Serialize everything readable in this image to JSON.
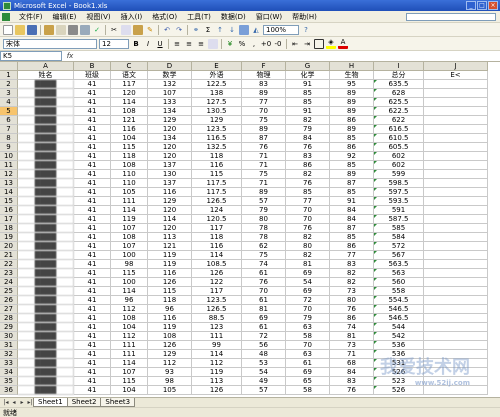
{
  "window": {
    "title": "Microsoft Excel - Book1.xls"
  },
  "menu": [
    "文件(F)",
    "编辑(E)",
    "视图(V)",
    "插入(I)",
    "格式(O)",
    "工具(T)",
    "数据(D)",
    "窗口(W)",
    "帮助(H)"
  ],
  "toolbar": {
    "zoom": "100%"
  },
  "format": {
    "font": "宋体",
    "size": "12"
  },
  "formula": {
    "cell": "K5",
    "fx": "fx",
    "value": ""
  },
  "columns": [
    "A",
    "B",
    "C",
    "D",
    "E",
    "F",
    "G",
    "H",
    "I",
    "J"
  ],
  "header_row": {
    "num": "1",
    "cells": [
      "姓名",
      "班级",
      "语文",
      "数学",
      "外语",
      "物理",
      "化学",
      "生物",
      "总分",
      "E<"
    ]
  },
  "rows": [
    {
      "num": "2",
      "cells": [
        "████",
        "41",
        "117",
        "132",
        "122.5",
        "83",
        "91",
        "95",
        "635.5",
        ""
      ]
    },
    {
      "num": "3",
      "cells": [
        "████",
        "41",
        "120",
        "107",
        "138",
        "89",
        "85",
        "89",
        "628",
        ""
      ]
    },
    {
      "num": "4",
      "cells": [
        "████",
        "41",
        "114",
        "133",
        "127.5",
        "77",
        "85",
        "89",
        "625.5",
        ""
      ]
    },
    {
      "num": "5",
      "cells": [
        "████",
        "41",
        "108",
        "134",
        "130.5",
        "70",
        "91",
        "89",
        "622.5",
        ""
      ]
    },
    {
      "num": "6",
      "cells": [
        "████",
        "41",
        "121",
        "129",
        "129",
        "75",
        "82",
        "86",
        "622",
        ""
      ]
    },
    {
      "num": "7",
      "cells": [
        "████",
        "41",
        "116",
        "120",
        "123.5",
        "89",
        "79",
        "89",
        "616.5",
        ""
      ]
    },
    {
      "num": "8",
      "cells": [
        "████",
        "41",
        "104",
        "134",
        "116.5",
        "87",
        "84",
        "85",
        "610.5",
        ""
      ]
    },
    {
      "num": "9",
      "cells": [
        "████",
        "41",
        "115",
        "120",
        "132.5",
        "76",
        "76",
        "86",
        "605.5",
        ""
      ]
    },
    {
      "num": "10",
      "cells": [
        "████",
        "41",
        "118",
        "120",
        "118",
        "71",
        "83",
        "92",
        "602",
        ""
      ]
    },
    {
      "num": "11",
      "cells": [
        "████",
        "41",
        "108",
        "137",
        "116",
        "71",
        "86",
        "85",
        "602",
        ""
      ]
    },
    {
      "num": "12",
      "cells": [
        "████",
        "41",
        "110",
        "130",
        "115",
        "75",
        "82",
        "89",
        "599",
        ""
      ]
    },
    {
      "num": "13",
      "cells": [
        "████",
        "41",
        "110",
        "137",
        "117.5",
        "71",
        "76",
        "87",
        "598.5",
        ""
      ]
    },
    {
      "num": "14",
      "cells": [
        "████",
        "41",
        "105",
        "116",
        "117.5",
        "89",
        "85",
        "85",
        "597.5",
        ""
      ]
    },
    {
      "num": "15",
      "cells": [
        "████",
        "41",
        "111",
        "129",
        "126.5",
        "57",
        "77",
        "91",
        "593.5",
        ""
      ]
    },
    {
      "num": "16",
      "cells": [
        "████",
        "41",
        "114",
        "120",
        "124",
        "79",
        "70",
        "84",
        "591",
        ""
      ]
    },
    {
      "num": "17",
      "cells": [
        "████",
        "41",
        "119",
        "114",
        "120.5",
        "80",
        "70",
        "84",
        "587.5",
        ""
      ]
    },
    {
      "num": "18",
      "cells": [
        "████",
        "41",
        "107",
        "120",
        "117",
        "78",
        "76",
        "87",
        "585",
        ""
      ]
    },
    {
      "num": "19",
      "cells": [
        "████",
        "41",
        "108",
        "113",
        "118",
        "78",
        "82",
        "85",
        "584",
        ""
      ]
    },
    {
      "num": "20",
      "cells": [
        "████",
        "41",
        "107",
        "121",
        "116",
        "62",
        "80",
        "86",
        "572",
        ""
      ]
    },
    {
      "num": "21",
      "cells": [
        "████",
        "41",
        "100",
        "119",
        "114",
        "75",
        "82",
        "77",
        "567",
        ""
      ]
    },
    {
      "num": "22",
      "cells": [
        "████",
        "41",
        "98",
        "119",
        "108.5",
        "74",
        "81",
        "83",
        "563.5",
        ""
      ]
    },
    {
      "num": "23",
      "cells": [
        "████",
        "41",
        "115",
        "116",
        "126",
        "61",
        "69",
        "82",
        "563",
        ""
      ]
    },
    {
      "num": "24",
      "cells": [
        "████",
        "41",
        "100",
        "126",
        "122",
        "76",
        "54",
        "82",
        "560",
        ""
      ]
    },
    {
      "num": "25",
      "cells": [
        "████",
        "41",
        "114",
        "115",
        "117",
        "70",
        "69",
        "73",
        "558",
        ""
      ]
    },
    {
      "num": "26",
      "cells": [
        "████",
        "41",
        "96",
        "118",
        "123.5",
        "61",
        "72",
        "80",
        "554.5",
        ""
      ]
    },
    {
      "num": "27",
      "cells": [
        "████",
        "41",
        "112",
        "96",
        "126.5",
        "81",
        "70",
        "76",
        "546.5",
        ""
      ]
    },
    {
      "num": "28",
      "cells": [
        "████",
        "41",
        "108",
        "116",
        "88.5",
        "69",
        "79",
        "86",
        "546.5",
        ""
      ]
    },
    {
      "num": "29",
      "cells": [
        "████",
        "41",
        "104",
        "119",
        "123",
        "61",
        "63",
        "74",
        "544",
        ""
      ]
    },
    {
      "num": "30",
      "cells": [
        "████",
        "41",
        "112",
        "108",
        "111",
        "72",
        "58",
        "81",
        "542",
        ""
      ]
    },
    {
      "num": "31",
      "cells": [
        "████",
        "41",
        "111",
        "126",
        "99",
        "56",
        "70",
        "73",
        "536",
        ""
      ]
    },
    {
      "num": "32",
      "cells": [
        "████",
        "41",
        "111",
        "129",
        "114",
        "48",
        "63",
        "71",
        "536",
        ""
      ]
    },
    {
      "num": "33",
      "cells": [
        "████",
        "41",
        "114",
        "112",
        "112",
        "53",
        "61",
        "68",
        "531",
        ""
      ]
    },
    {
      "num": "34",
      "cells": [
        "████",
        "41",
        "107",
        "93",
        "119",
        "54",
        "69",
        "84",
        "526",
        ""
      ]
    },
    {
      "num": "35",
      "cells": [
        "████",
        "41",
        "115",
        "98",
        "113",
        "49",
        "65",
        "83",
        "523",
        ""
      ]
    },
    {
      "num": "36",
      "cells": [
        "████",
        "41",
        "104",
        "105",
        "126",
        "57",
        "58",
        "76",
        "526",
        ""
      ]
    }
  ],
  "sheets": [
    "Sheet1",
    "Sheet2",
    "Sheet3"
  ],
  "status": "就绪",
  "watermark": {
    "text": "我爱技术网",
    "url": "www.52ij.com"
  },
  "accent_color": "#2e8b3a"
}
